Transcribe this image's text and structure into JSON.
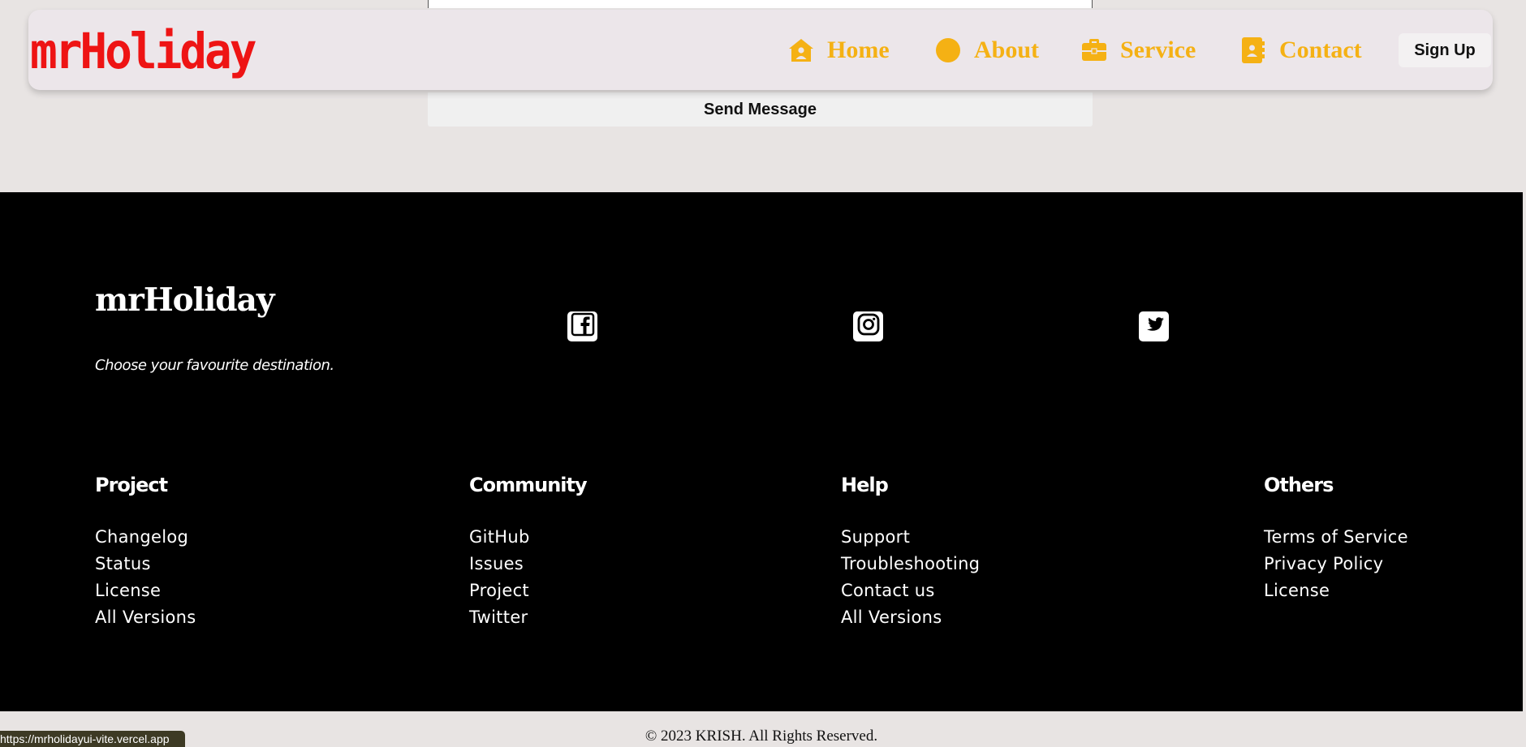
{
  "form": {
    "send_label": "Send Message"
  },
  "navbar": {
    "logo": "mrHoliday",
    "links": [
      {
        "label": "Home",
        "icon": "house-user-icon"
      },
      {
        "label": "About",
        "icon": "circle-icon"
      },
      {
        "label": "Service",
        "icon": "briefcase-icon"
      },
      {
        "label": "Contact",
        "icon": "address-book-icon"
      }
    ],
    "signup_label": "Sign Up"
  },
  "footer": {
    "brand": "mrHoliday",
    "tagline": "Choose your favourite destination.",
    "social": [
      "facebook-icon",
      "instagram-icon",
      "twitter-icon"
    ],
    "columns": [
      {
        "title": "Project",
        "links": [
          "Changelog",
          "Status",
          "License",
          "All Versions"
        ]
      },
      {
        "title": "Community",
        "links": [
          "GitHub",
          "Issues",
          "Project",
          "Twitter"
        ]
      },
      {
        "title": "Help",
        "links": [
          "Support",
          "Troubleshooting",
          "Contact us",
          "All Versions"
        ]
      },
      {
        "title": "Others",
        "links": [
          "Terms of Service",
          "Privacy Policy",
          "License"
        ]
      }
    ]
  },
  "copyright": "© 2023 KRISH. All Rights Reserved.",
  "status_bar": {
    "url": "https://mrholidayui-vite.vercel.app"
  },
  "colors": {
    "logo_red": "#ee1414",
    "nav_gold": "#f5b114",
    "navbar_bg": "#ece6ea",
    "page_bg": "#e8e4e3",
    "footer_bg": "#000000"
  }
}
